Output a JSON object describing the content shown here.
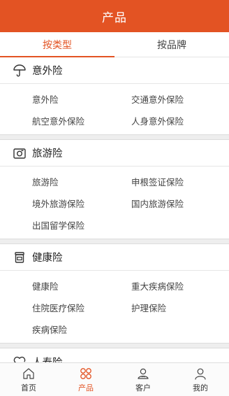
{
  "header": {
    "title": "产品"
  },
  "tabs": [
    {
      "label": "按类型",
      "active": true
    },
    {
      "label": "按品牌",
      "active": false
    }
  ],
  "sections": [
    {
      "title": "意外险",
      "icon": "umbrella-icon",
      "items": [
        "意外险",
        "交通意外保险",
        "航空意外保险",
        "人身意外保险"
      ]
    },
    {
      "title": "旅游险",
      "icon": "camera-icon",
      "items": [
        "旅游险",
        "申根签证保险",
        "境外旅游保险",
        "国内旅游保险",
        "出国留学保险"
      ]
    },
    {
      "title": "健康险",
      "icon": "medicine-jar-icon",
      "items": [
        "健康险",
        "重大疾病保险",
        "住院医疗保险",
        "护理保险",
        "疾病保险"
      ]
    },
    {
      "title": "人寿险",
      "icon": "heart-plus-icon",
      "items": []
    }
  ],
  "bottom_nav": [
    {
      "label": "首页",
      "icon": "home-icon",
      "active": false
    },
    {
      "label": "产品",
      "icon": "products-grid-icon",
      "active": true
    },
    {
      "label": "客户",
      "icon": "customers-icon",
      "active": false
    },
    {
      "label": "我的",
      "icon": "profile-icon",
      "active": false
    }
  ],
  "colors": {
    "accent": "#e35323",
    "divider_bg": "#eeeeee"
  }
}
